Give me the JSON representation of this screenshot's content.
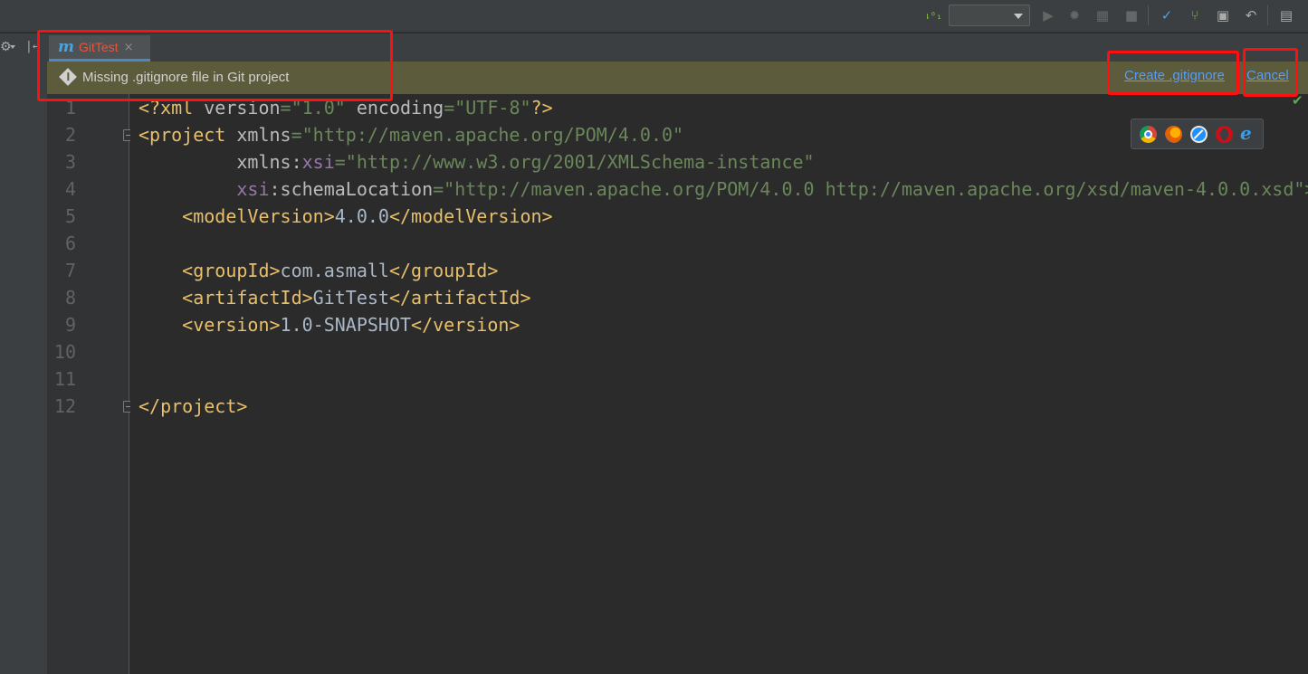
{
  "editor_tab": {
    "icon_letter": "m",
    "title": "GitTest",
    "close_glyph": "×"
  },
  "notification": {
    "message": "Missing .gitignore file in Git project",
    "create_label": "Create .gitignore",
    "cancel_label": "Cancel"
  },
  "line_numbers": [
    "1",
    "2",
    "3",
    "4",
    "5",
    "6",
    "7",
    "8",
    "9",
    "10",
    "11",
    "12"
  ],
  "code": {
    "l1": {
      "open": "<?xml",
      "sp1": " version",
      "eq1": "=",
      "v1": "\"1.0\"",
      "sp2": " encoding",
      "eq2": "=",
      "v2": "\"UTF-8\"",
      "close": "?>"
    },
    "l2": {
      "open": "<project",
      "attr": " xmlns",
      "eq": "=",
      "val": "\"http://maven.apache.org/POM/4.0.0\""
    },
    "l3": {
      "indent": "         ",
      "attr": "xmlns:",
      "ns": "xsi",
      "eq": "=",
      "val": "\"http://www.w3.org/2001/XMLSchema-instance\""
    },
    "l4": {
      "indent": "         ",
      "ns": "xsi",
      "attr": ":schemaLocation",
      "eq": "=",
      "val": "\"http://maven.apache.org/POM/4.0.0 http://maven.apache.org/xsd/maven-4.0.0.xsd\">"
    },
    "l5": {
      "indent": "    ",
      "open": "<modelVersion>",
      "text": "4.0.0",
      "close": "</modelVersion>"
    },
    "l7": {
      "indent": "    ",
      "open": "<groupId>",
      "text": "com.asmall",
      "close": "</groupId>"
    },
    "l8": {
      "indent": "    ",
      "open": "<artifactId>",
      "text": "GitTest",
      "close": "</artifactId>"
    },
    "l9": {
      "indent": "    ",
      "open": "<version>",
      "text": "1.0-SNAPSHOT",
      "close": "</version>"
    },
    "l12": {
      "close": "</project>"
    }
  },
  "icons": {
    "toolbar": [
      "sort-vcs-icon",
      "run-icon",
      "debug-icon",
      "coverage-icon",
      "stop-icon",
      "vcs-update-icon",
      "vcs-branch-icon",
      "vcs-commit-icon",
      "revert-icon",
      "structure-icon"
    ],
    "browsers": [
      "chrome-icon",
      "firefox-icon",
      "safari-icon",
      "opera-icon",
      "ie-icon"
    ],
    "status": "inspection-ok-icon"
  },
  "colors": {
    "tag": "#e8bf6a",
    "attribute": "#bababa",
    "namespace": "#9876aa",
    "string": "#6a8759",
    "text": "#a9b7c6",
    "notification_bg": "#5c5b3b",
    "link": "#589df6",
    "highlight_box": "#ff1010",
    "tab_title": "#e8543b"
  }
}
